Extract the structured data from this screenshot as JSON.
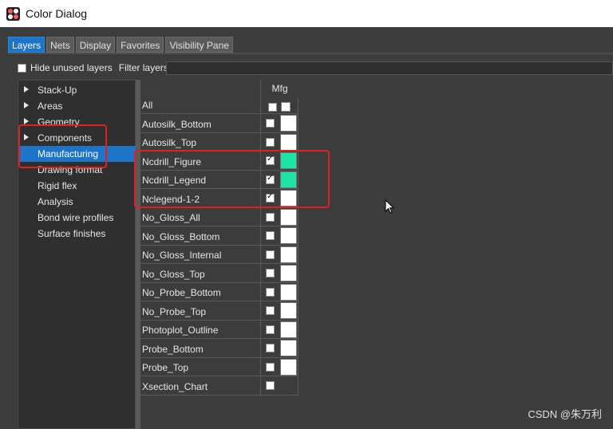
{
  "window": {
    "title": "Color Dialog"
  },
  "tabs": [
    "Layers",
    "Nets",
    "Display",
    "Favorites",
    "Visibility Pane"
  ],
  "active_tab": "Layers",
  "filter": {
    "hide_unused_label": "Hide unused layers",
    "hide_unused_checked": false,
    "filter_label": "Filter layers:",
    "filter_value": ""
  },
  "tree": {
    "items": [
      {
        "label": "Stack-Up",
        "expandable": true
      },
      {
        "label": "Areas",
        "expandable": true
      },
      {
        "label": "Geometry",
        "expandable": true
      },
      {
        "label": "Components",
        "expandable": true
      },
      {
        "label": "Manufacturing",
        "expandable": false,
        "selected": true
      },
      {
        "label": "Drawing format",
        "expandable": false
      },
      {
        "label": "Rigid flex",
        "expandable": false
      },
      {
        "label": "Analysis",
        "expandable": false
      },
      {
        "label": "Bond wire profiles",
        "expandable": false
      },
      {
        "label": "Surface finishes",
        "expandable": false
      }
    ]
  },
  "grid": {
    "column_header": "Mfg",
    "all_label": "All",
    "rows": [
      {
        "name": "Autosilk_Bottom",
        "checked": false,
        "color": "#ffffff"
      },
      {
        "name": "Autosilk_Top",
        "checked": false,
        "color": "#ffffff"
      },
      {
        "name": "Ncdrill_Figure",
        "checked": true,
        "color": "#1de3a6"
      },
      {
        "name": "Ncdrill_Legend",
        "checked": true,
        "color": "#1de3a6"
      },
      {
        "name": "Nclegend-1-2",
        "checked": true,
        "color": "#ffffff"
      },
      {
        "name": "No_Gloss_All",
        "checked": false,
        "color": "#ffffff"
      },
      {
        "name": "No_Gloss_Bottom",
        "checked": false,
        "color": "#ffffff"
      },
      {
        "name": "No_Gloss_Internal",
        "checked": false,
        "color": "#ffffff"
      },
      {
        "name": "No_Gloss_Top",
        "checked": false,
        "color": "#ffffff"
      },
      {
        "name": "No_Probe_Bottom",
        "checked": false,
        "color": "#ffffff"
      },
      {
        "name": "No_Probe_Top",
        "checked": false,
        "color": "#ffffff"
      },
      {
        "name": "Photoplot_Outline",
        "checked": false,
        "color": "#ffffff"
      },
      {
        "name": "Probe_Bottom",
        "checked": false,
        "color": "#ffffff"
      },
      {
        "name": "Probe_Top",
        "checked": false,
        "color": "#ffffff"
      },
      {
        "name": "Xsection_Chart",
        "checked": false,
        "color": null
      }
    ]
  },
  "colors": {
    "selection": "#1e74c6",
    "annotation": "#e02020"
  },
  "watermark": "CSDN @朱万利"
}
